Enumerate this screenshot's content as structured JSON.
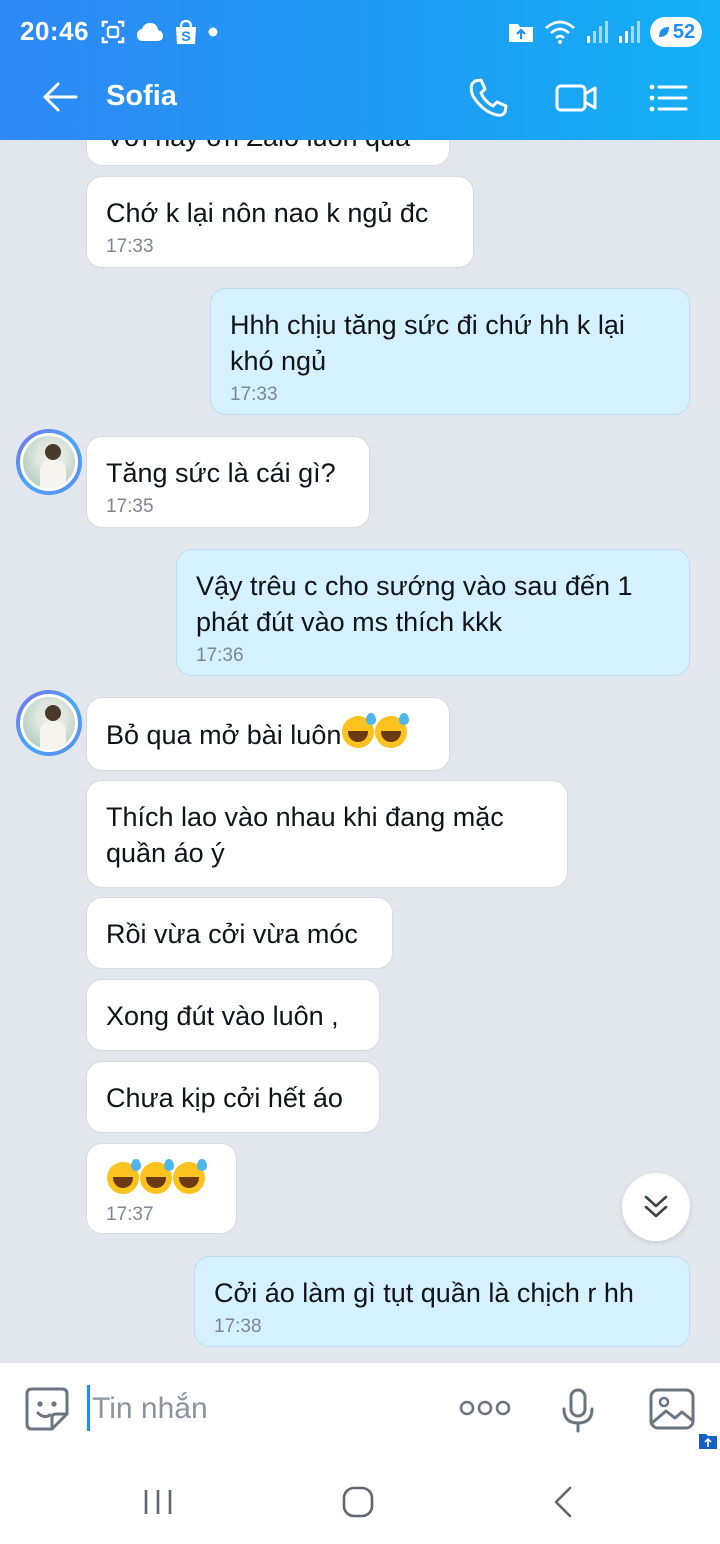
{
  "status_bar": {
    "time": "20:46",
    "battery": "52"
  },
  "header": {
    "contact_name": "Sofia"
  },
  "messages": [
    {
      "dir": "in",
      "text": "Với này ơn Zalo luôn quá",
      "time": ""
    },
    {
      "dir": "in",
      "text": "Chớ k lại nôn nao k ngủ đc",
      "time": "17:33"
    },
    {
      "dir": "out",
      "text": "Hhh chịu tăng sức đi chứ hh k lại khó ngủ",
      "time": "17:33"
    },
    {
      "dir": "in",
      "text": "Tăng sức là cái gì?",
      "time": "17:35"
    },
    {
      "dir": "out",
      "text": "Vậy trêu c cho sướng vào sau đến 1 phát đút vào ms thích kkk",
      "time": "17:36"
    },
    {
      "dir": "in",
      "text": "Bỏ qua mở bài luôn",
      "time": ""
    },
    {
      "dir": "in",
      "text": "Thích lao vào nhau khi đang mặc quần áo ý",
      "time": ""
    },
    {
      "dir": "in",
      "text": "Rồi vừa cởi vừa móc",
      "time": ""
    },
    {
      "dir": "in",
      "text": "Xong đút vào luôn ,",
      "time": ""
    },
    {
      "dir": "in",
      "text": "Chưa kịp cởi hết áo",
      "time": ""
    },
    {
      "dir": "in",
      "text": "",
      "time": "17:37"
    },
    {
      "dir": "out",
      "text": "Cởi áo làm gì tụt quần là chịch r hh",
      "time": "17:38"
    }
  ],
  "composer": {
    "placeholder": "Tin nhắn"
  },
  "icons": {
    "back": "arrow-left-icon",
    "call": "phone-icon",
    "video": "video-camera-icon",
    "menu": "list-menu-icon",
    "emoji": "grinning-sweat-emoji",
    "scroll": "chevron-double-down-icon",
    "sticker": "sticker-smile-icon",
    "more": "more-dots-icon",
    "mic": "microphone-icon",
    "image": "image-icon"
  },
  "colors": {
    "header_start": "#2e89f6",
    "header_end": "#14b0f4",
    "outgoing_bubble": "#d5f1ff",
    "incoming_bubble": "#ffffff",
    "chat_background": "#e2e7ee",
    "accent": "#1e8ff0"
  }
}
